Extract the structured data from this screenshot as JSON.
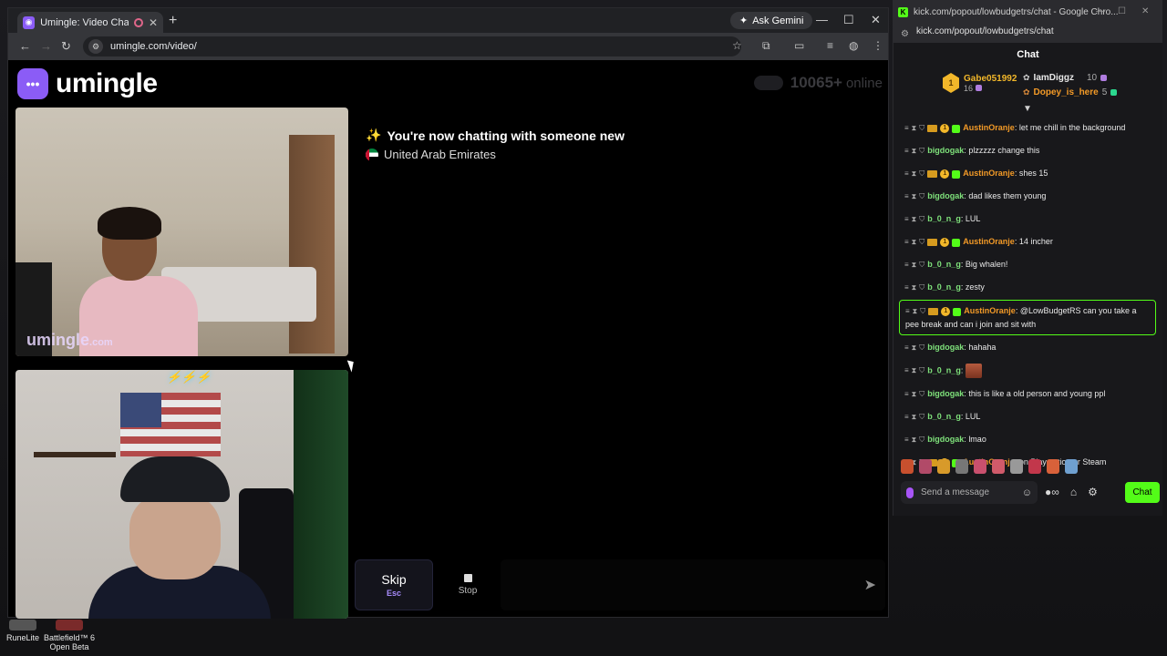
{
  "browser_left": {
    "tab_title": "Umingle: Video Chat with S",
    "gemini_label": "Ask Gemini",
    "url": "umingle.com/video/"
  },
  "site": {
    "logo_text": "umingle",
    "online_count": "10065+",
    "online_label": "online",
    "watermark": "umingle",
    "watermark_suffix": ".com"
  },
  "status": {
    "line1": "You're now chatting with someone new",
    "line2": "United Arab Emirates"
  },
  "controls": {
    "skip_label": "Skip",
    "skip_shortcut": "Esc",
    "stop_label": "Stop"
  },
  "desktop": {
    "items": [
      "RuneLite",
      "Battlefield™ 6 Open Beta"
    ]
  },
  "browser_right": {
    "title": "kick.com/popout/lowbudgetrs/chat - Google Chro...",
    "url": "kick.com/popout/lowbudgetrs/chat",
    "chat_header": "Chat",
    "leaderboard": {
      "first_name": "Gabe051992",
      "first_count": "16",
      "second_name": "IamDiggz",
      "second_count": "10",
      "third_name": "Dopey_is_here",
      "third_count": "5"
    },
    "messages": [
      {
        "user": "AustinOranje",
        "text": "let me chill in the background",
        "color": "orange"
      },
      {
        "user": "bigdogak",
        "text": "plzzzzz change this",
        "color": "green"
      },
      {
        "user": "AustinOranje",
        "text": "shes 15",
        "color": "orange"
      },
      {
        "user": "bigdogak",
        "text": "dad likes them young",
        "color": "green"
      },
      {
        "user": "b_0_n_g",
        "text": "LUL",
        "color": "green"
      },
      {
        "user": "AustinOranje",
        "text": "14 incher",
        "color": "orange"
      },
      {
        "user": "b_0_n_g",
        "text": "Big whalen!",
        "color": "green"
      },
      {
        "user": "b_0_n_g",
        "text": "zesty",
        "color": "green"
      },
      {
        "user": "AustinOranje",
        "text": "@LowBudgetRS can you take a pee break and can i join and sit with",
        "color": "orange"
      },
      {
        "user": "bigdogak",
        "text": "hahaha",
        "color": "green"
      },
      {
        "user": "b_0_n_g",
        "text": "",
        "color": "green"
      },
      {
        "user": "bigdogak",
        "text": "this is like a old person and young ppl",
        "color": "green"
      },
      {
        "user": "b_0_n_g",
        "text": "LUL",
        "color": "green"
      },
      {
        "user": "bigdogak",
        "text": "lmao",
        "color": "green"
      },
      {
        "user": "AustinOranje",
        "text": "on Playstation or Steam",
        "color": "orange"
      }
    ],
    "input_placeholder": "Send a message",
    "chat_button": "Chat"
  },
  "colors": {
    "umingle_purple": "#8b5cf6",
    "kick_green": "#53fc18",
    "username_orange": "#f39a27",
    "username_green": "#7ee07a"
  }
}
